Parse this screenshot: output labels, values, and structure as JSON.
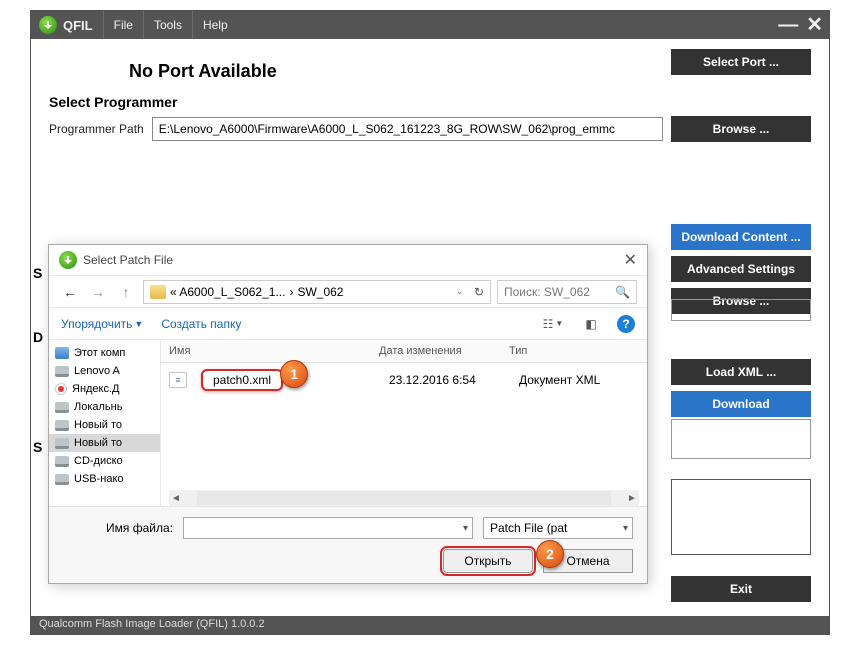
{
  "app": {
    "title": "QFIL",
    "status_bar": "Qualcomm Flash Image Loader (QFIL)  1.0.0.2"
  },
  "menu": {
    "file": "File",
    "tools": "Tools",
    "help": "Help"
  },
  "port_status": "No Port Available",
  "programmer": {
    "section_title": "Select Programmer",
    "path_label": "Programmer Path",
    "path_value": "E:\\Lenovo_A6000\\Firmware\\A6000_L_S062_161223_8G_ROW\\SW_062\\prog_emmc"
  },
  "buttons": {
    "select_port": "Select Port ...",
    "browse": "Browse ...",
    "download_content": "Download Content ...",
    "advanced_settings": "Advanced Settings",
    "load_xml": "Load XML ...",
    "download": "Download",
    "exit": "Exit"
  },
  "partial_labels": {
    "s1": "S",
    "d": "D",
    "s2": "S"
  },
  "dialog": {
    "title": "Select Patch File",
    "breadcrumb": {
      "pre": "« A6000_L_S062_1...",
      "sep": "›",
      "leaf": "SW_062"
    },
    "search_placeholder": "Поиск: SW_062",
    "toolbar": {
      "organize": "Упорядочить",
      "new_folder": "Создать папку"
    },
    "tree": [
      {
        "label": "Этот комп",
        "icon": "monitor"
      },
      {
        "label": "Lenovo A",
        "icon": "disk"
      },
      {
        "label": "Яндекс.Д",
        "icon": "yandex"
      },
      {
        "label": "Локальнь",
        "icon": "disk"
      },
      {
        "label": "Новый то",
        "icon": "disk"
      },
      {
        "label": "Новый то",
        "icon": "disk",
        "selected": true
      },
      {
        "label": "CD-диско",
        "icon": "disk"
      },
      {
        "label": "USB-нако",
        "icon": "disk"
      }
    ],
    "columns": {
      "name": "Имя",
      "date": "Дата изменения",
      "type": "Тип"
    },
    "files": [
      {
        "name": "patch0.xml",
        "date": "23.12.2016 6:54",
        "type": "Документ XML"
      }
    ],
    "footer": {
      "fname_label": "Имя файла:",
      "fname_value": "",
      "filter_value": "Patch File (pat",
      "open": "Открыть",
      "cancel": "Отмена"
    }
  },
  "callouts": {
    "c1": "1",
    "c2": "2"
  }
}
